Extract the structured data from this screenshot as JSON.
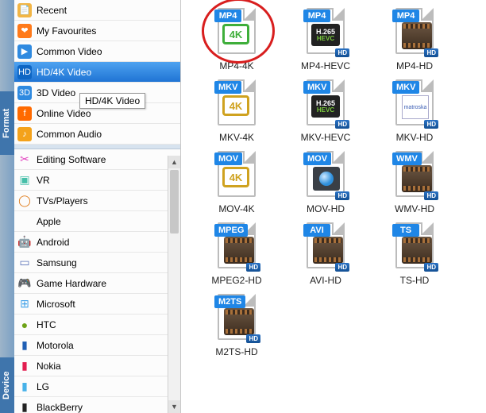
{
  "side_tabs": {
    "format": "Format",
    "device": "Device"
  },
  "tooltip": "HD/4K Video",
  "format_categories": [
    {
      "label": "Recent",
      "icon_bg": "#f2b545",
      "icon_txt": "📄",
      "selected": false
    },
    {
      "label": "My Favourites",
      "icon_bg": "#ff7a1a",
      "icon_txt": "❤",
      "selected": false
    },
    {
      "label": "Common Video",
      "icon_bg": "#2f8ae0",
      "icon_txt": "▶",
      "selected": false
    },
    {
      "label": "HD/4K Video",
      "icon_bg": "#0e66c4",
      "icon_txt": "HD",
      "selected": true
    },
    {
      "label": "3D Video",
      "icon_bg": "#2f8ae0",
      "icon_txt": "3D",
      "selected": false
    },
    {
      "label": "Online Video",
      "icon_bg": "#ff6a00",
      "icon_txt": "f",
      "selected": false
    },
    {
      "label": "Common Audio",
      "icon_bg": "#f4a21b",
      "icon_txt": "♪",
      "selected": false
    }
  ],
  "device_categories": [
    {
      "label": "Editing Software",
      "icon_color": "#e23fbf",
      "icon_txt": "✂"
    },
    {
      "label": "VR",
      "icon_color": "#46bfa9",
      "icon_txt": "▣"
    },
    {
      "label": "TVs/Players",
      "icon_color": "#e07e1e",
      "icon_txt": "◯"
    },
    {
      "label": "Apple",
      "icon_color": "#7a7a7a",
      "icon_txt": ""
    },
    {
      "label": "Android",
      "icon_color": "#8fb53a",
      "icon_txt": "🤖"
    },
    {
      "label": "Samsung",
      "icon_color": "#5b73b9",
      "icon_txt": "▭"
    },
    {
      "label": "Game Hardware",
      "icon_color": "#7a7a7a",
      "icon_txt": "🎮"
    },
    {
      "label": "Microsoft",
      "icon_color": "#3fa0e8",
      "icon_txt": "⊞"
    },
    {
      "label": "HTC",
      "icon_color": "#6ea317",
      "icon_txt": "●"
    },
    {
      "label": "Motorola",
      "icon_color": "#1f5fb5",
      "icon_txt": "▮"
    },
    {
      "label": "Nokia",
      "icon_color": "#e21e50",
      "icon_txt": "▮"
    },
    {
      "label": "LG",
      "icon_color": "#47b2e9",
      "icon_txt": "▮"
    },
    {
      "label": "BlackBerry",
      "icon_color": "#222222",
      "icon_txt": "▮"
    }
  ],
  "formats": [
    {
      "ext": "MP4",
      "badge": "4k-green",
      "hd": false,
      "label": "MP4-4K",
      "circled": true
    },
    {
      "ext": "MP4",
      "badge": "hevc",
      "hd": true,
      "label": "MP4-HEVC"
    },
    {
      "ext": "MP4",
      "badge": "thumb",
      "hd": true,
      "label": "MP4-HD"
    },
    {
      "ext": "MKV",
      "badge": "4k-gold",
      "hd": false,
      "label": "MKV-4K"
    },
    {
      "ext": "MKV",
      "badge": "hevc",
      "hd": true,
      "label": "MKV-HEVC"
    },
    {
      "ext": "MKV",
      "badge": "matroska",
      "hd": true,
      "label": "MKV-HD"
    },
    {
      "ext": "MOV",
      "badge": "4k-gold",
      "hd": false,
      "label": "MOV-4K"
    },
    {
      "ext": "MOV",
      "badge": "qt",
      "hd": true,
      "label": "MOV-HD"
    },
    {
      "ext": "WMV",
      "badge": "thumb",
      "hd": true,
      "label": "WMV-HD"
    },
    {
      "ext": "MPEG",
      "badge": "thumb",
      "hd": true,
      "label": "MPEG2-HD"
    },
    {
      "ext": "AVI",
      "badge": "thumb",
      "hd": true,
      "label": "AVI-HD"
    },
    {
      "ext": "TS",
      "badge": "thumb",
      "hd": true,
      "label": "TS-HD"
    },
    {
      "ext": "M2TS",
      "badge": "thumb",
      "hd": true,
      "label": "M2TS-HD"
    }
  ]
}
